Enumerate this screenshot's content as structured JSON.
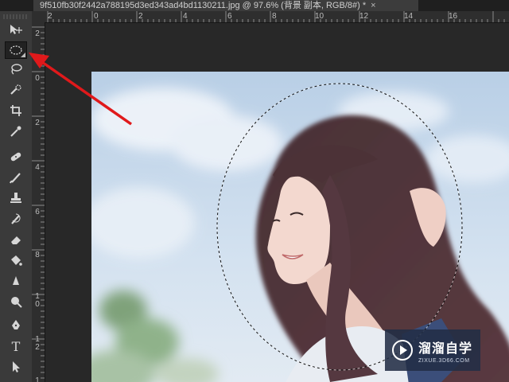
{
  "document": {
    "tab_title": "9f510fb30f2442a788195d3ed343ad4bd1130211.jpg @ 97.6% (背景 副本, RGB/8#) *",
    "close_glyph": "×"
  },
  "rulers": {
    "top_labels": [
      "2",
      "0",
      "2",
      "4",
      "6",
      "8",
      "10",
      "12",
      "14",
      "16"
    ],
    "left_labels": [
      "2",
      "0",
      "2",
      "4",
      "6",
      "8",
      "1\n0",
      "1\n2",
      "1\n4"
    ]
  },
  "toolbar": {
    "selected_tool": "elliptical-marquee-tool",
    "tools": [
      {
        "name": "move-tool",
        "icon": "move-icon"
      },
      {
        "name": "elliptical-marquee-tool",
        "icon": "ellipse-icon"
      },
      {
        "name": "lasso-tool",
        "icon": "lasso-icon"
      },
      {
        "name": "quick-selection-tool",
        "icon": "quick-select-icon"
      },
      {
        "name": "crop-tool",
        "icon": "crop-icon"
      },
      {
        "name": "eyedropper-tool",
        "icon": "eyedropper-icon"
      },
      {
        "name": "healing-brush-tool",
        "icon": "bandage-icon"
      },
      {
        "name": "brush-tool",
        "icon": "brush-icon"
      },
      {
        "name": "clone-stamp-tool",
        "icon": "stamp-icon"
      },
      {
        "name": "history-brush-tool",
        "icon": "history-brush-icon"
      },
      {
        "name": "eraser-tool",
        "icon": "eraser-icon"
      },
      {
        "name": "paint-bucket-tool",
        "icon": "bucket-icon"
      },
      {
        "name": "blur-tool",
        "icon": "blur-icon"
      },
      {
        "name": "dodge-tool",
        "icon": "dodge-icon"
      },
      {
        "name": "pen-tool",
        "icon": "pen-icon"
      },
      {
        "name": "type-tool",
        "icon": "type-icon",
        "glyph": "T"
      },
      {
        "name": "path-selection-tool",
        "icon": "path-select-icon"
      },
      {
        "name": "shape-tool",
        "icon": "shape-icon"
      }
    ]
  },
  "watermark": {
    "title": "溜溜自学",
    "url": "ZIXUE.3D66.COM"
  },
  "colors": {
    "annotation_arrow": "#e0191b",
    "ui_background": "#282828",
    "toolbar": "#3a3a3a",
    "watermark_bg": "#222e46"
  }
}
